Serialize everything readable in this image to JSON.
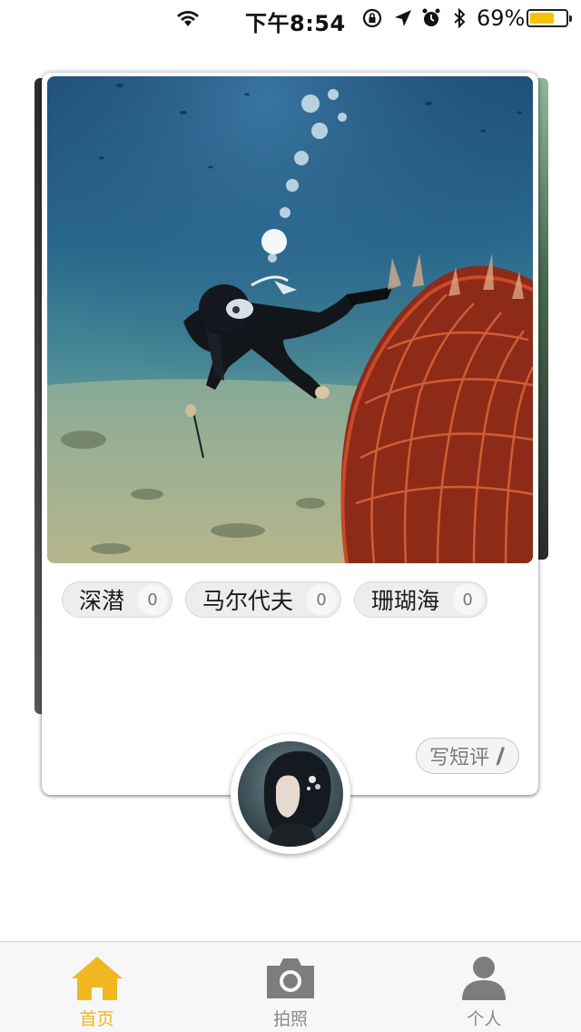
{
  "status_bar": {
    "time": "下午8:54",
    "battery_percent": "69%",
    "battery_level": 0.69,
    "icons": [
      "wifi-icon",
      "orientation-lock-icon",
      "location-arrow-icon",
      "alarm-icon",
      "bluetooth-icon",
      "battery-icon"
    ]
  },
  "card": {
    "photo_subject": "underwater-diver-photo",
    "tags": [
      {
        "label": "深潜",
        "count": "0"
      },
      {
        "label": "马尔代夫",
        "count": "0"
      },
      {
        "label": "珊瑚海",
        "count": "0"
      }
    ],
    "review_button_label": "写短评",
    "avatar": "user-avatar"
  },
  "tab_bar": {
    "active_index": 0,
    "active_color": "#f0b721",
    "inactive_color": "#8a8a8a",
    "tabs": [
      {
        "label": "首页",
        "icon": "home-icon"
      },
      {
        "label": "拍照",
        "icon": "camera-icon"
      },
      {
        "label": "个人",
        "icon": "person-icon"
      }
    ]
  }
}
